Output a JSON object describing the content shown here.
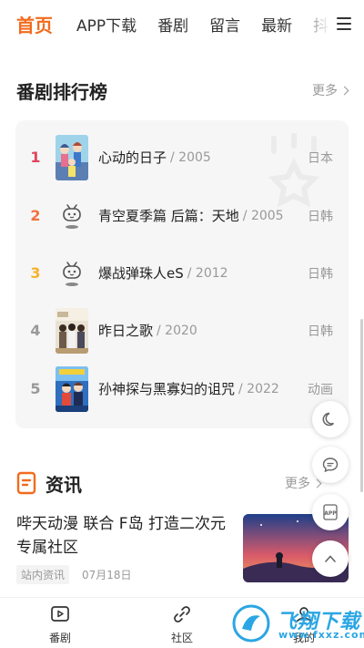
{
  "topnav": {
    "tabs": [
      {
        "label": "首页",
        "active": true
      },
      {
        "label": "APP下载"
      },
      {
        "label": "番剧"
      },
      {
        "label": "留言"
      },
      {
        "label": "最新"
      },
      {
        "label": "抖"
      }
    ],
    "menu_icon": "hamburger-icon"
  },
  "ranking": {
    "title": "番剧排行榜",
    "more": "更多",
    "items": [
      {
        "rank": "1",
        "name": "心动的日子",
        "year": "/ 2005",
        "region": "日本",
        "rank_color": "#e2435b"
      },
      {
        "rank": "2",
        "name": "青空夏季篇 后篇：天地",
        "year": "/ 2005",
        "region": "日韩",
        "rank_color": "#f0723f"
      },
      {
        "rank": "3",
        "name": "爆战弹珠人eS",
        "year": "/ 2012",
        "region": "日韩",
        "rank_color": "#f4b32e"
      },
      {
        "rank": "4",
        "name": "昨日之歌",
        "year": "/ 2020",
        "region": "日韩",
        "rank_color": "#999999"
      },
      {
        "rank": "5",
        "name": "孙神探与黑寡妇的诅咒",
        "year": "/ 2022",
        "region": "动画",
        "rank_color": "#999999"
      }
    ]
  },
  "news": {
    "title": "资讯",
    "more": "更多",
    "headline": "哔天动漫 联合 F岛 打造二次元专属社区",
    "tag": "站内资讯",
    "date": "07月18日"
  },
  "bottomnav": {
    "items": [
      {
        "label": "番剧",
        "icon": "play-icon"
      },
      {
        "label": "社区",
        "icon": "link-icon"
      },
      {
        "label": "我的",
        "icon": "user-icon"
      }
    ]
  },
  "watermark": {
    "text": "飞翔下载",
    "url": "www.fxxz.com"
  },
  "colors": {
    "accent": "#f26b1d",
    "watermark": "#2ba6e4"
  }
}
